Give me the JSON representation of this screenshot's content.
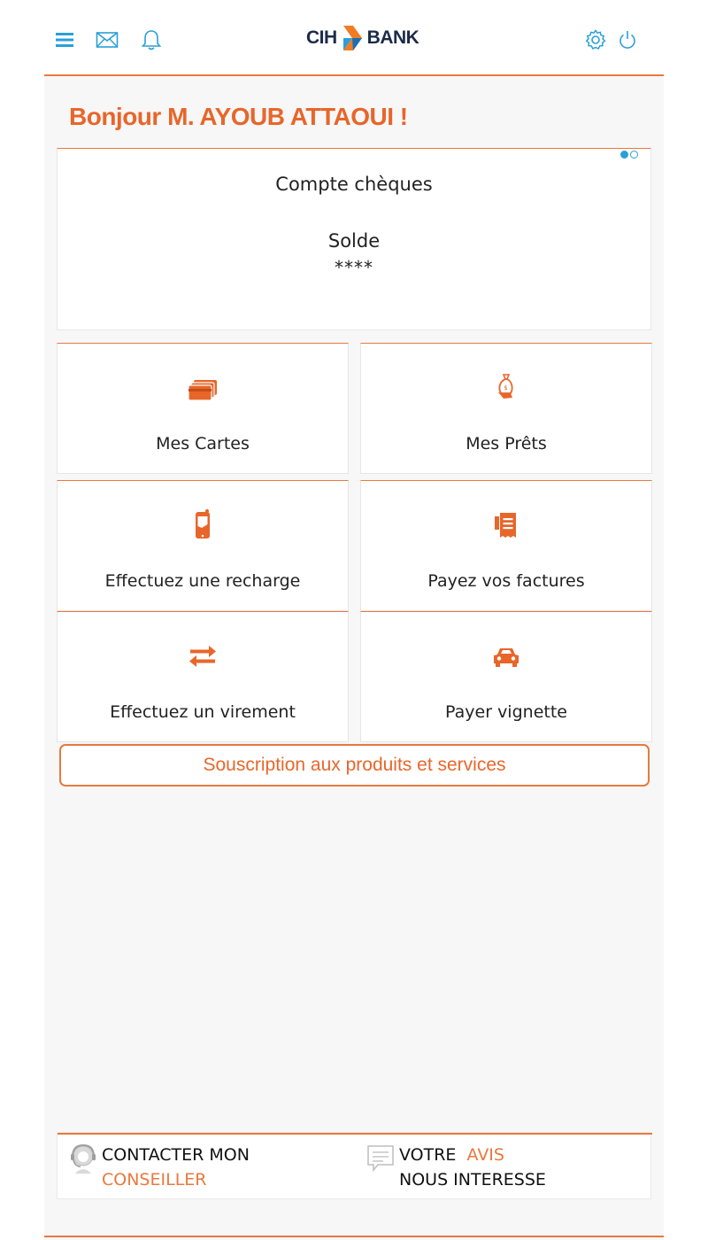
{
  "topbar": {
    "icons": [
      "menu-icon",
      "mail-icon",
      "bell-icon",
      "settings-icon",
      "power-icon"
    ],
    "logo_left": "CIH",
    "logo_right": "BANK"
  },
  "greeting": "Bonjour M. AYOUB ATTAOUI !",
  "account": {
    "type": "Compte chèques",
    "balance_label": "Solde",
    "balance_value": "****",
    "carousel_pages": 2,
    "carousel_active": 1
  },
  "tiles": [
    {
      "label": "Mes Cartes",
      "icon": "cards-icon"
    },
    {
      "label": "Mes Prêts",
      "icon": "money-bag-icon"
    },
    {
      "label": "Effectuez une recharge",
      "icon": "phone-recharge-icon"
    },
    {
      "label": "Payez vos factures",
      "icon": "receipt-icon"
    },
    {
      "label": "Effectuez un virement",
      "icon": "transfer-arrows-icon"
    },
    {
      "label": "Payer vignette",
      "icon": "car-icon"
    }
  ],
  "subscribe_label": "Souscription aux produits et services",
  "footer": {
    "contact": {
      "line1": "CONTACTER MON",
      "line2": "CONSEILLER",
      "icon": "advisor-headset-icon"
    },
    "feedback": {
      "line1_a": "VOTRE",
      "line1_b": "AVIS",
      "line2": "NOUS INTERESSE",
      "icon": "speech-bubble-icon"
    }
  },
  "colors": {
    "accent": "#e8662a",
    "accent_border": "#e8793e",
    "icon_blue": "#2a9fd8",
    "logo_dark": "#1c2b4a"
  }
}
